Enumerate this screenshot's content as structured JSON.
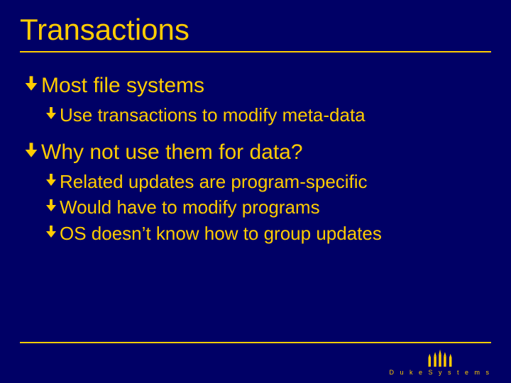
{
  "title": "Transactions",
  "bullets": {
    "b1": "Most file systems",
    "b1a": "Use transactions to modify meta-data",
    "b2": "Why not use them for data?",
    "b2a": "Related updates are program-specific",
    "b2b": "Would have to modify programs",
    "b2c": "OS doesn’t know how to group updates"
  },
  "footer": {
    "brand": "D u k e   S y s t e m s"
  }
}
